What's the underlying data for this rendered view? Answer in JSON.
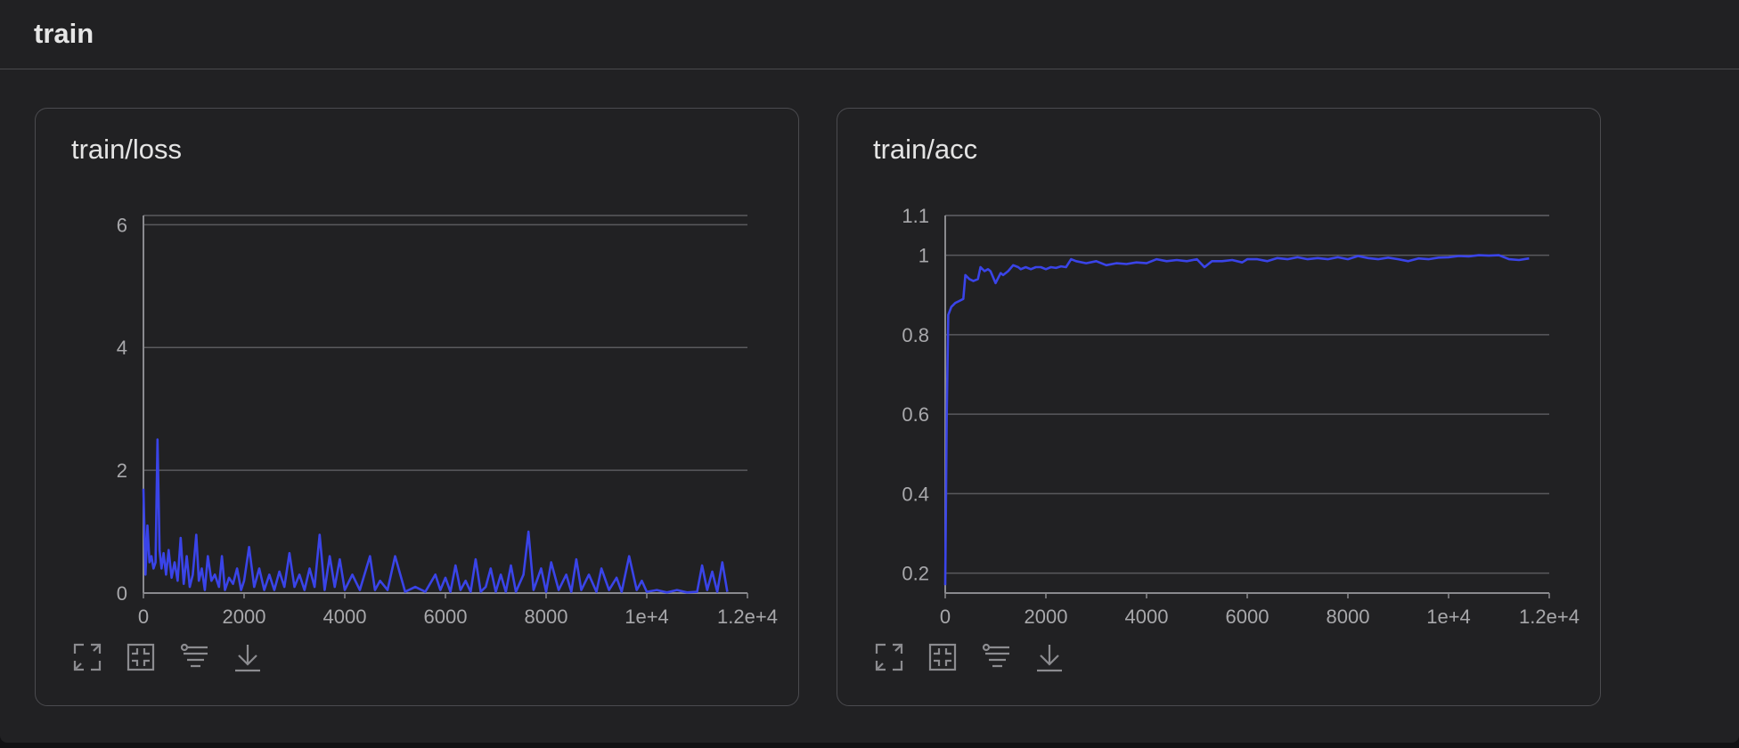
{
  "section": {
    "title": "train"
  },
  "charts": [
    {
      "title": "train/loss",
      "icons": [
        "fullscreen-icon",
        "fit-icon",
        "filter-icon",
        "download-icon"
      ]
    },
    {
      "title": "train/acc",
      "icons": [
        "fullscreen-icon",
        "fit-icon",
        "filter-icon",
        "download-icon"
      ]
    }
  ],
  "colors": {
    "line": "#3a44e8",
    "grid": "#5a5a5e",
    "axis": "#8a8a8e",
    "tick_text": "#a8a8ab"
  },
  "chart_data": [
    {
      "type": "line",
      "title": "train/loss",
      "xlim": [
        0,
        12000
      ],
      "ylim": [
        0,
        6.15
      ],
      "x_ticks": [
        0,
        2000,
        4000,
        6000,
        8000,
        10000,
        12000
      ],
      "x_tick_labels": [
        "0",
        "2000",
        "4000",
        "6000",
        "8000",
        "1e+4",
        "1.2e+4"
      ],
      "y_ticks": [
        0,
        2,
        4,
        6
      ],
      "y_tick_labels": [
        "0",
        "2",
        "4",
        "6"
      ],
      "grid": true,
      "series": [
        {
          "x": [
            0,
            40,
            80,
            120,
            160,
            200,
            240,
            280,
            320,
            360,
            400,
            450,
            500,
            560,
            620,
            680,
            740,
            800,
            860,
            920,
            980,
            1050,
            1100,
            1160,
            1220,
            1280,
            1350,
            1420,
            1500,
            1560,
            1620,
            1700,
            1780,
            1860,
            1940,
            2000,
            2100,
            2200,
            2300,
            2400,
            2500,
            2600,
            2700,
            2800,
            2900,
            3000,
            3100,
            3200,
            3300,
            3400,
            3500,
            3600,
            3700,
            3800,
            3900,
            4000,
            4150,
            4300,
            4500,
            4600,
            4700,
            4850,
            5000,
            5200,
            5400,
            5600,
            5800,
            5900,
            6000,
            6100,
            6200,
            6300,
            6400,
            6500,
            6600,
            6700,
            6800,
            6900,
            7000,
            7100,
            7200,
            7300,
            7400,
            7550,
            7650,
            7750,
            7900,
            8000,
            8100,
            8250,
            8400,
            8500,
            8600,
            8700,
            8850,
            9000,
            9100,
            9250,
            9400,
            9500,
            9650,
            9800,
            9900,
            10000,
            10200,
            10400,
            10600,
            10800,
            11000,
            11100,
            11200,
            11300,
            11400,
            11500,
            11600
          ],
          "y": [
            1.7,
            0.3,
            1.1,
            0.5,
            0.6,
            0.4,
            0.5,
            2.5,
            0.7,
            0.4,
            0.65,
            0.3,
            0.7,
            0.25,
            0.5,
            0.2,
            0.9,
            0.15,
            0.6,
            0.1,
            0.3,
            0.95,
            0.2,
            0.4,
            0.05,
            0.6,
            0.2,
            0.3,
            0.1,
            0.6,
            0.05,
            0.25,
            0.15,
            0.4,
            0.05,
            0.2,
            0.75,
            0.1,
            0.4,
            0.05,
            0.3,
            0.05,
            0.35,
            0.1,
            0.65,
            0.1,
            0.3,
            0.05,
            0.4,
            0.1,
            0.95,
            0.05,
            0.6,
            0.1,
            0.55,
            0.05,
            0.3,
            0.05,
            0.6,
            0.05,
            0.2,
            0.05,
            0.6,
            0.02,
            0.1,
            0.02,
            0.3,
            0.05,
            0.25,
            0.02,
            0.45,
            0.05,
            0.2,
            0.02,
            0.55,
            0.02,
            0.1,
            0.4,
            0.02,
            0.3,
            0.02,
            0.45,
            0.02,
            0.3,
            1.0,
            0.05,
            0.4,
            0.02,
            0.5,
            0.05,
            0.3,
            0.02,
            0.55,
            0.05,
            0.3,
            0.02,
            0.4,
            0.05,
            0.25,
            0.02,
            0.6,
            0.05,
            0.2,
            0.02,
            0.05,
            0.01,
            0.05,
            0.01,
            0.02,
            0.45,
            0.05,
            0.35,
            0.02,
            0.5,
            0.02
          ]
        }
      ]
    },
    {
      "type": "line",
      "title": "train/acc",
      "xlim": [
        0,
        12000
      ],
      "ylim": [
        0.15,
        1.1
      ],
      "x_ticks": [
        0,
        2000,
        4000,
        6000,
        8000,
        10000,
        12000
      ],
      "x_tick_labels": [
        "0",
        "2000",
        "4000",
        "6000",
        "8000",
        "1e+4",
        "1.2e+4"
      ],
      "y_ticks": [
        0.2,
        0.4,
        0.6,
        0.8,
        1,
        1.1
      ],
      "y_tick_labels": [
        "0.2",
        "0.4",
        "0.6",
        "0.8",
        "1",
        "1.1"
      ],
      "grid": true,
      "series": [
        {
          "x": [
            0,
            30,
            60,
            120,
            200,
            280,
            360,
            400,
            480,
            560,
            650,
            700,
            780,
            850,
            900,
            1000,
            1100,
            1150,
            1250,
            1350,
            1450,
            1500,
            1600,
            1700,
            1800,
            1900,
            2000,
            2100,
            2200,
            2300,
            2400,
            2500,
            2600,
            2800,
            3000,
            3200,
            3400,
            3600,
            3800,
            4000,
            4200,
            4400,
            4600,
            4800,
            5000,
            5150,
            5300,
            5500,
            5700,
            5900,
            6000,
            6200,
            6400,
            6600,
            6800,
            7000,
            7200,
            7400,
            7600,
            7800,
            8000,
            8200,
            8400,
            8600,
            8800,
            9000,
            9200,
            9400,
            9600,
            9800,
            10000,
            10200,
            10400,
            10600,
            10800,
            11000,
            11200,
            11400,
            11600
          ],
          "y": [
            0.17,
            0.6,
            0.85,
            0.87,
            0.88,
            0.885,
            0.89,
            0.95,
            0.94,
            0.935,
            0.94,
            0.97,
            0.96,
            0.965,
            0.96,
            0.93,
            0.955,
            0.95,
            0.96,
            0.975,
            0.97,
            0.965,
            0.97,
            0.965,
            0.97,
            0.97,
            0.965,
            0.97,
            0.968,
            0.972,
            0.97,
            0.99,
            0.985,
            0.98,
            0.985,
            0.975,
            0.98,
            0.978,
            0.982,
            0.98,
            0.99,
            0.985,
            0.988,
            0.985,
            0.99,
            0.97,
            0.985,
            0.985,
            0.988,
            0.982,
            0.99,
            0.99,
            0.985,
            0.993,
            0.99,
            0.995,
            0.99,
            0.993,
            0.99,
            0.995,
            0.99,
            0.998,
            0.993,
            0.99,
            0.994,
            0.99,
            0.985,
            0.992,
            0.99,
            0.994,
            0.995,
            0.998,
            0.997,
            1.0,
            0.999,
            1.0,
            0.99,
            0.988,
            0.992
          ]
        }
      ]
    }
  ]
}
